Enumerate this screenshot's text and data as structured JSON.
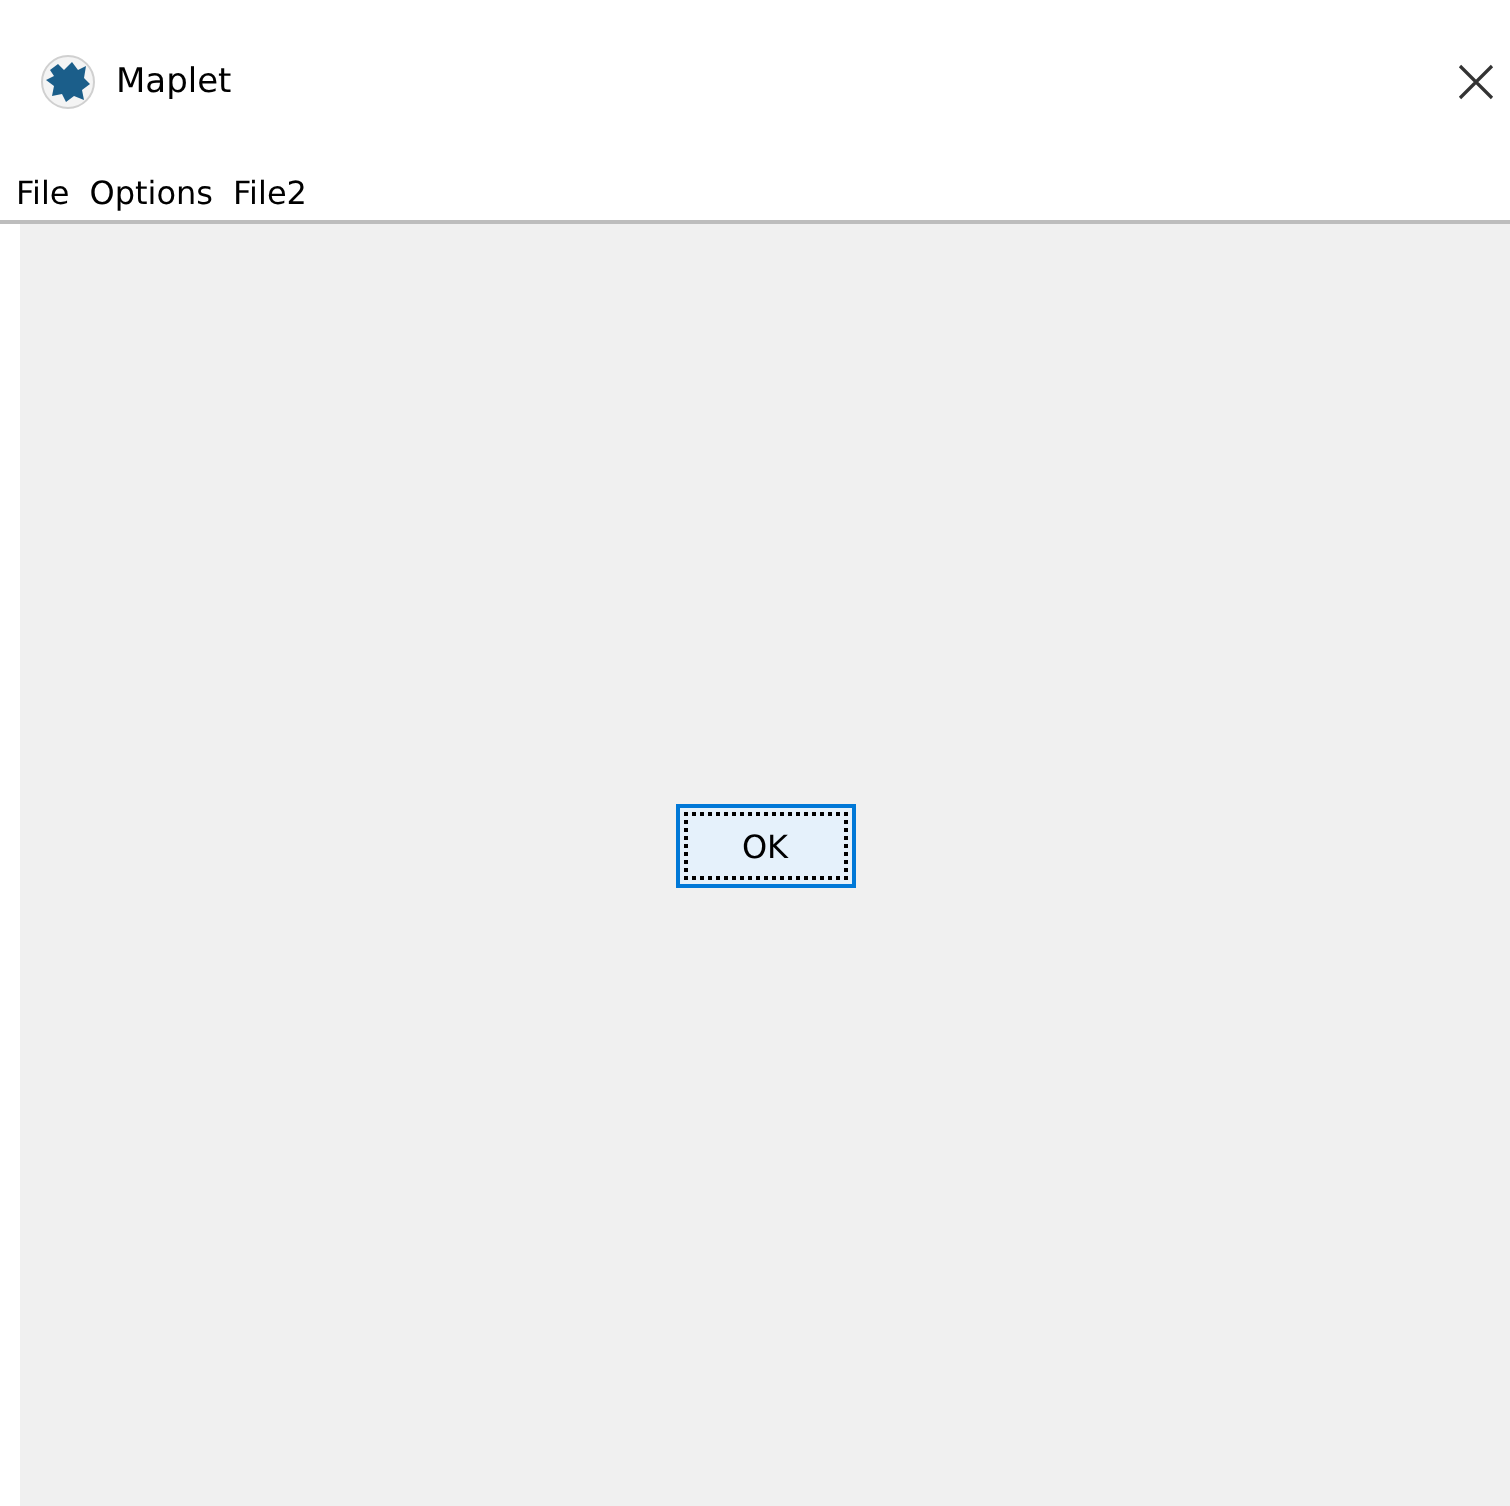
{
  "window": {
    "title": "Maplet"
  },
  "menu": [
    {
      "label": "File"
    },
    {
      "label": "Options"
    },
    {
      "label": "File2"
    }
  ],
  "button": {
    "label": "OK",
    "focused": true
  }
}
